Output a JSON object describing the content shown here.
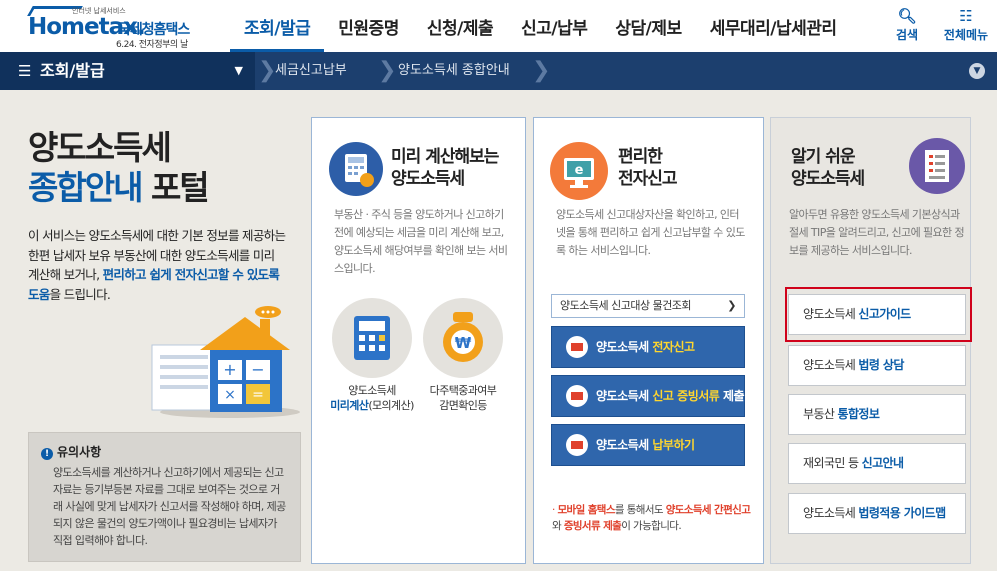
{
  "logo": {
    "small_text": "인터넷 납세서비스",
    "wordmark": "Hometax.",
    "title": "국세청홈택스",
    "subtitle": "6.24. 전자정부의 날"
  },
  "gnb": {
    "items": [
      "조회/발급",
      "민원증명",
      "신청/제출",
      "신고/납부",
      "상담/제보",
      "세무대리/납세관리"
    ],
    "active_index": 0
  },
  "top_icons": {
    "search": "검색",
    "all_menu": "전체메뉴"
  },
  "nav": {
    "menu": "조회/발급",
    "crumbs": [
      "세금신고납부",
      "양도소득세 종합안내"
    ]
  },
  "hero": {
    "line1": "양도소득세",
    "line2_blue": "종합안내",
    "line2_rest": " 포털"
  },
  "desc": {
    "p1": "이 서비스는 양도소득세에 대한 기본 정보를 제공하는 한편 납세자 보유 부동산에 대한 양도소득세를 미리 계산해 보거나, ",
    "hl": "편리하고 쉽게 전자신고할 수 있도록 도움",
    "p2": "을 드립니다."
  },
  "notice": {
    "title": "유의사항",
    "body": "양도소득세를 계산하거나 신고하기에서 제공되는 신고 자료는 등기부등본 자료를 그대로 보여주는 것으로 거래 사실에 맞게 납세자가 신고서를 작성해야 하며, 제공되지 않은 물건의 양도가액이나 필요경비는 납세자가 직접 입력해야 합니다."
  },
  "panel1": {
    "title1": "미리 계산해보는",
    "title2": "양도소득세",
    "desc": "부동산 · 주식 등을 양도하거나 신고하기 전에 예상되는 세금을 미리 계산해 보고, 양도소득세 해당여부를 확인해 보는 서비스입니다.",
    "item1_l1": "양도소득세",
    "item1_l2": "미리계산",
    "item1_l2b": "(모의계산)",
    "item2_l1": "다주택중과여부",
    "item2_l2": "감면확인등"
  },
  "panel2": {
    "title1": "편리한",
    "title2": "전자신고",
    "desc": "양도소득세 신고대상자산을 확인하고, 인터넷을 통해 편리하고 쉽게 신고납부할 수 있도록 하는 서비스입니다.",
    "lookup": "양도소득세 신고대상 물건조회",
    "btn1_a": "양도소득세 ",
    "btn1_b": "전자신고",
    "btn2_a": "양도소득세 ",
    "btn2_b": "신고 증빙서류",
    "btn2_c": " 제출",
    "btn3_a": "양도소득세 ",
    "btn3_b": "납부하기",
    "note_a": "모바일 홈택스",
    "note_b": "를 통해서도 ",
    "note_c": "양도소득세 간편신고",
    "note_d": "와 ",
    "note_e": "증빙서류 제출",
    "note_f": "이 가능합니다."
  },
  "panel3": {
    "title1": "알기 쉬운",
    "title2": "양도소득세",
    "desc": "알아두면 유용한 양도소득세 기본상식과 절세 TIP을 알려드리고, 신고에 필요한 정보를 제공하는 서비스입니다.",
    "guides": [
      {
        "a": "양도소득세 ",
        "b": "신고가이드"
      },
      {
        "a": "양도소득세 ",
        "b": "법령 상담"
      },
      {
        "a": "부동산 ",
        "b": "통합정보"
      },
      {
        "a": "재외국민 등 ",
        "b": "신고안내"
      },
      {
        "a": "양도소득세 ",
        "b": "법령적용 가이드맵"
      }
    ]
  }
}
